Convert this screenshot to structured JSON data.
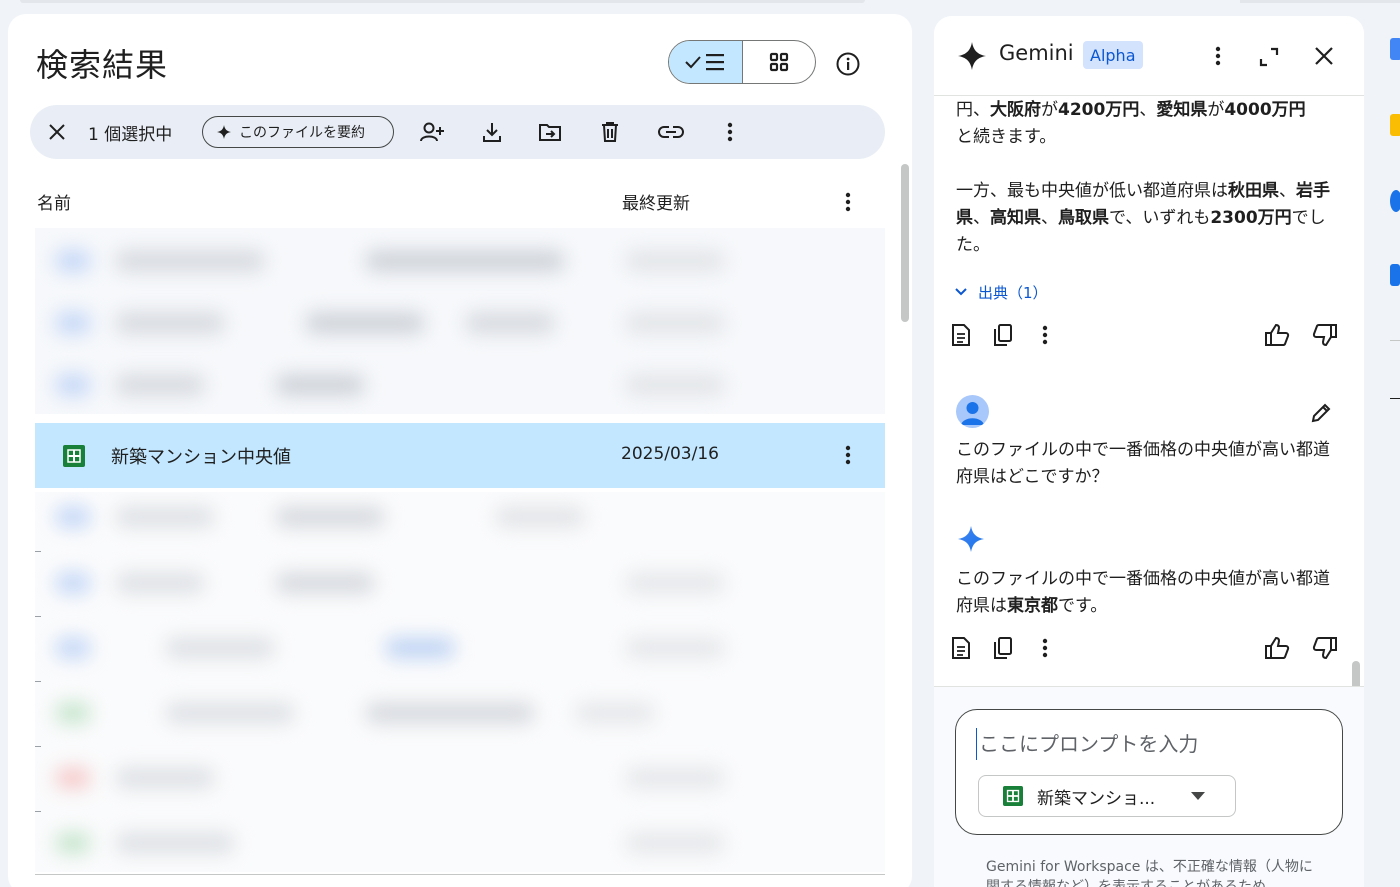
{
  "left": {
    "title": "検索結果",
    "selection": {
      "count_label": "1 個選択中",
      "summarize_label": "このファイルを要約"
    },
    "columns": {
      "name": "名前",
      "modified": "最終更新"
    },
    "selected_file": {
      "name": "新築マンション中央値",
      "modified": "2025/03/16",
      "icon": "sheets-icon",
      "icon_color": "#188038"
    }
  },
  "gemini": {
    "title": "Gemini",
    "badge": "Alpha",
    "answer_prev": {
      "line1_p1": "円、",
      "line1_b1": "大阪府",
      "line1_p2": "が",
      "line1_b2": "4200万円",
      "line1_p3": "、",
      "line1_b3": "愛知県",
      "line1_p4": "が",
      "line1_b4": "4000万円",
      "line2": "と続きます。",
      "para2_p1": "一方、最も中央値が低い都道府県は",
      "para2_b1": "秋田県",
      "para2_p2": "、",
      "para2_b2": "岩手県",
      "para2_p3": "、",
      "para2_b3": "高知県",
      "para2_p4": "、",
      "para2_b4": "鳥取県",
      "para2_p5": "で、いずれも",
      "para2_b5": "2300万",
      "para2_b6": "円",
      "para2_p6": "でした。"
    },
    "sources_label": "出典（1）",
    "user_question": "このファイルの中で一番価格の中央値が高い都道府県はどこですか？",
    "reply": {
      "p1": "このファイルの中で一番価格の中央値が高い都道府県は",
      "b1": "東京都",
      "p2": "です。"
    },
    "prompt_placeholder": "ここにプロンプトを入力",
    "file_chip_label": "新築マンショ...",
    "disclaimer": "Gemini for Workspace は、不正確な情報（人物に関する情報など）を表示することがあるため"
  },
  "colors": {
    "accent": "#0b57d0",
    "selected_row": "#c2e7ff",
    "selection_bar": "#e9eef6",
    "gemini_star": "#1a73e8"
  }
}
